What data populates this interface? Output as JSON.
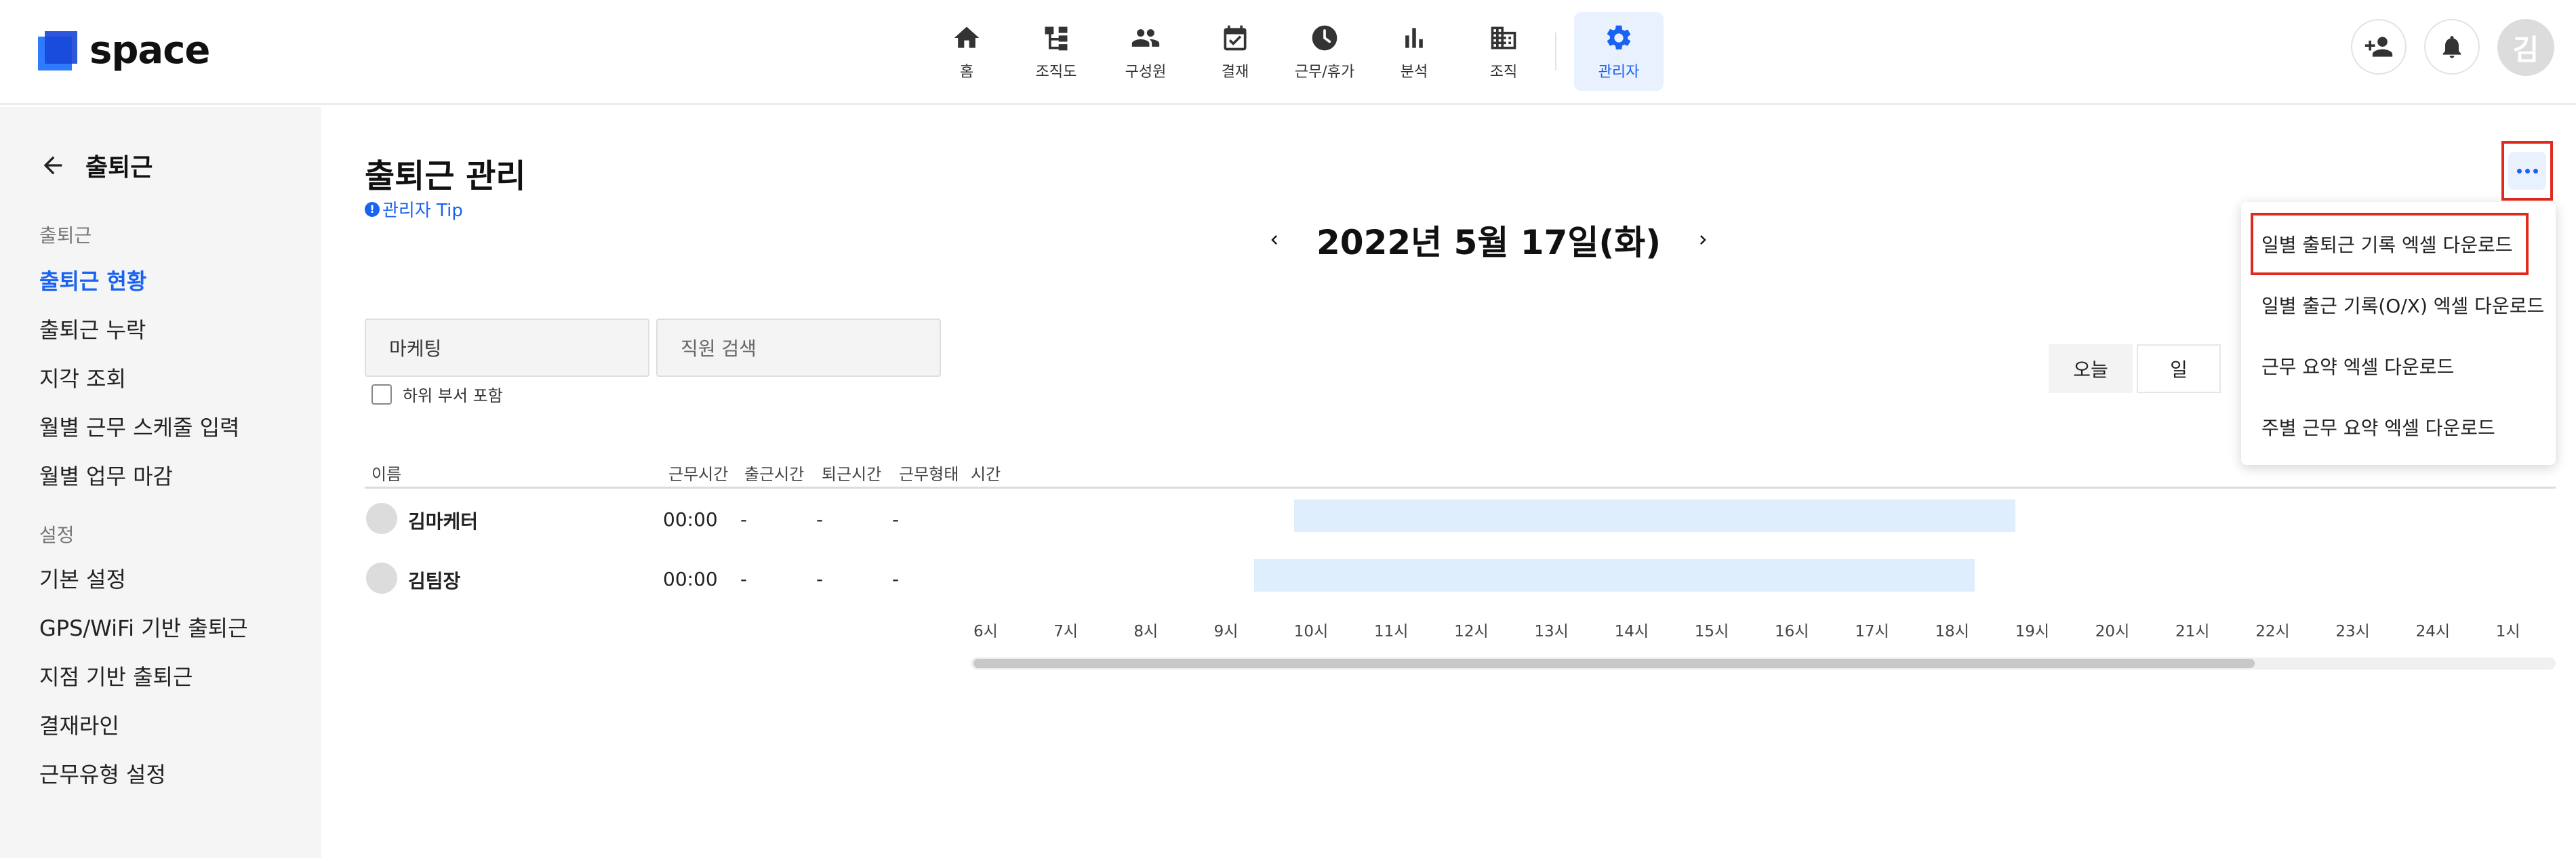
{
  "brand": {
    "name": "space"
  },
  "nav": [
    {
      "label": "홈",
      "icon": "home-icon"
    },
    {
      "label": "조직도",
      "icon": "org-chart-icon"
    },
    {
      "label": "구성원",
      "icon": "people-icon"
    },
    {
      "label": "결재",
      "icon": "approval-icon"
    },
    {
      "label": "근무/휴가",
      "icon": "clock-icon"
    },
    {
      "label": "분석",
      "icon": "bar-chart-icon"
    },
    {
      "label": "조직",
      "icon": "building-icon"
    },
    {
      "label": "관리자",
      "icon": "gear-icon",
      "active": true
    }
  ],
  "header_right": {
    "avatar_initial": "김"
  },
  "sidebar": {
    "title": "출퇴근",
    "sections": [
      {
        "label": "출퇴근",
        "items": [
          "출퇴근 현황",
          "출퇴근 누락",
          "지각 조회",
          "월별 근무 스케줄 입력",
          "월별 업무 마감"
        ]
      },
      {
        "label": "설정",
        "items": [
          "기본 설정",
          "GPS/WiFi 기반 출퇴근",
          "지점 기반 출퇴근",
          "결재라인",
          "근무유형 설정"
        ]
      }
    ],
    "active_item": "출퇴근 현황"
  },
  "main": {
    "title": "출퇴근 관리",
    "tip": "관리자 Tip",
    "tip_icon": "!",
    "date": "2022년 5월 17일(화)",
    "department": "마케팅",
    "search_placeholder": "직원 검색",
    "include_sub": "하위 부서 포함",
    "view_today": "오늘",
    "view_day": "일"
  },
  "menu": {
    "items": [
      "일별 출퇴근 기록 엑셀 다운로드",
      "일별 출근 기록(O/X) 엑셀 다운로드",
      "근무 요약 엑셀 다운로드",
      "주별 근무 요약 엑셀 다운로드"
    ],
    "highlighted_index": 0
  },
  "table": {
    "headers": [
      "이름",
      "근무시간",
      "출근시간",
      "퇴근시간",
      "근무형태",
      "시간"
    ],
    "rows": [
      {
        "name": "김마케터",
        "work_time": "00:00",
        "check_in": "-",
        "check_out": "-",
        "work_type": "-",
        "schedule_start_hour": 10,
        "schedule_end_hour": 19
      },
      {
        "name": "김팀장",
        "work_time": "00:00",
        "check_in": "-",
        "check_out": "-",
        "work_type": "-",
        "schedule_start_hour": 9.5,
        "schedule_end_hour": 18.5
      }
    ],
    "hours": [
      "6시",
      "7시",
      "8시",
      "9시",
      "10시",
      "11시",
      "12시",
      "13시",
      "14시",
      "15시",
      "16시",
      "17시",
      "18시",
      "19시",
      "20시",
      "21시",
      "22시",
      "23시",
      "24시",
      "1시"
    ]
  },
  "colors": {
    "accent": "#1a63f0",
    "highlight_border": "#e02a1f",
    "schedule_bar": "#dfeefc"
  }
}
